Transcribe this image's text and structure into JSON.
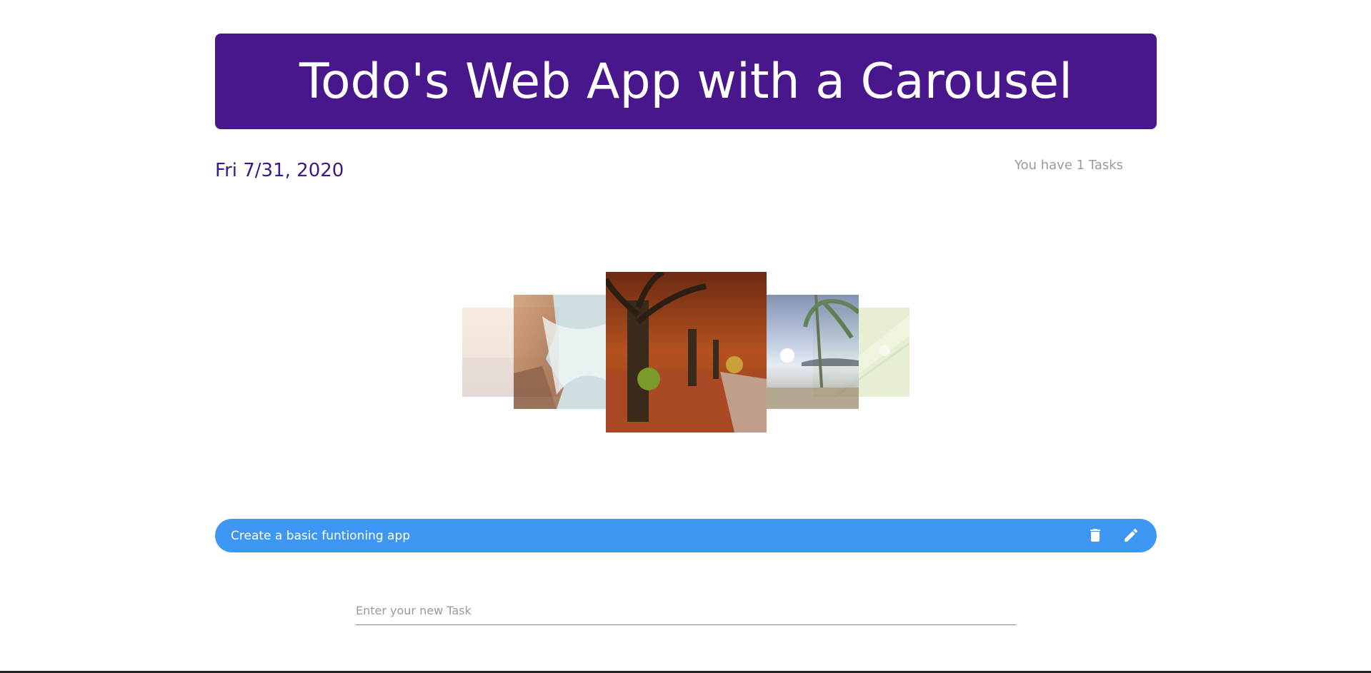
{
  "header": {
    "title": "Todo's Web App with a Carousel",
    "background_color": "#48178c"
  },
  "date": "Fri 7/31, 2020",
  "task_count_text": "You have 1 Tasks",
  "carousel": {
    "slides": [
      {
        "name": "pale-seascape"
      },
      {
        "name": "rocky-coast-waves"
      },
      {
        "name": "autumn-tree-avenue"
      },
      {
        "name": "tropical-beach-sunset"
      },
      {
        "name": "green-leaf-closeup"
      }
    ],
    "active_index": 2
  },
  "tasks": [
    {
      "text": "Create a basic funtioning app"
    }
  ],
  "task_bar_color": "#3d96f2",
  "task_actions": {
    "delete_icon": "trash-icon",
    "edit_icon": "pencil-icon"
  },
  "new_task": {
    "placeholder": "Enter your new Task",
    "value": ""
  }
}
